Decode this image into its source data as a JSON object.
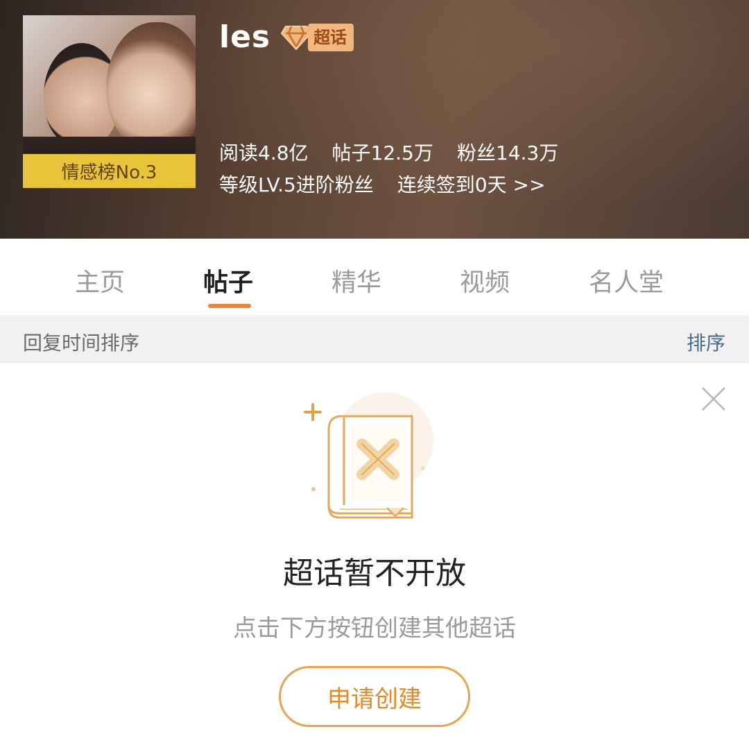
{
  "header": {
    "title": "les",
    "badge_label": "超话",
    "rank_label": "情感榜No.3",
    "stats_row1": [
      "阅读4.8亿",
      "帖子12.5万",
      "粉丝14.3万"
    ],
    "stats_row2": [
      "等级LV.5进阶粉丝",
      "连续签到0天 >>"
    ]
  },
  "tabs": [
    {
      "label": "主页",
      "active": false
    },
    {
      "label": "帖子",
      "active": true
    },
    {
      "label": "精华",
      "active": false
    },
    {
      "label": "视频",
      "active": false
    },
    {
      "label": "名人堂",
      "active": false
    }
  ],
  "sortbar": {
    "label": "回复时间排序",
    "button": "排序"
  },
  "empty_state": {
    "title": "超话暂不开放",
    "subtitle": "点击下方按钮创建其他超话",
    "button": "申请创建"
  },
  "colors": {
    "accent": "#e8843c",
    "rank_bg": "#e9c43a",
    "badge_bg": "#f1b77e",
    "button_border": "#e9a24d"
  },
  "icons": {
    "badge": "diamond-icon",
    "close": "close-icon",
    "empty": "closed-book-icon"
  }
}
